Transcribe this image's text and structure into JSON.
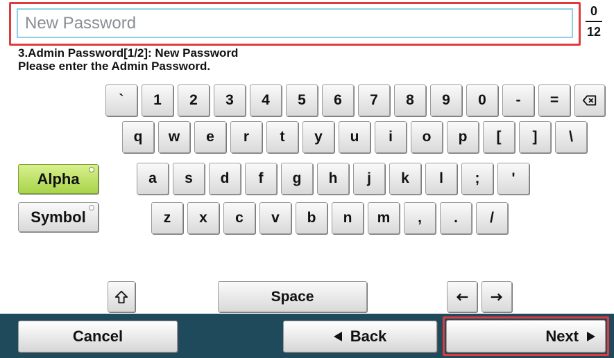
{
  "input": {
    "placeholder": "New Password",
    "value": ""
  },
  "counter": {
    "current": "0",
    "max": "12"
  },
  "info": {
    "line1": "3.Admin Password[1/2]: New Password",
    "line2": "Please enter the Admin Password."
  },
  "modes": {
    "alpha": "Alpha",
    "symbol": "Symbol"
  },
  "rows": {
    "row1": [
      "`",
      "1",
      "2",
      "3",
      "4",
      "5",
      "6",
      "7",
      "8",
      "9",
      "0",
      "-",
      "="
    ],
    "row2": [
      "q",
      "w",
      "e",
      "r",
      "t",
      "y",
      "u",
      "i",
      "o",
      "p",
      "[",
      "]",
      "\\"
    ],
    "row3": [
      "a",
      "s",
      "d",
      "f",
      "g",
      "h",
      "j",
      "k",
      "l",
      ";",
      "'"
    ],
    "row4": [
      "z",
      "x",
      "c",
      "v",
      "b",
      "n",
      "m",
      ",",
      ".",
      "/"
    ]
  },
  "icons": {
    "backspace": "backspace-icon",
    "shift": "shift-icon",
    "left": "arrow-left-icon",
    "right": "arrow-right-icon"
  },
  "space_label": "Space",
  "footer": {
    "cancel": "Cancel",
    "back": "Back",
    "next": "Next"
  },
  "colors": {
    "highlight": "#e03a3a",
    "alpha_active": "#b6de5a",
    "footer_bar": "#1f4a5c",
    "input_border": "#8ccfe6"
  }
}
